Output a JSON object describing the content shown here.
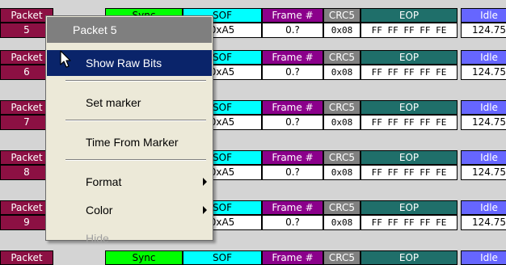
{
  "header_labels": {
    "packet": "Packet",
    "sync": "Sync",
    "sof": "SOF",
    "frame": "Frame #",
    "crc5": "CRC5",
    "eop": "EOP",
    "idle": "Idle"
  },
  "rows": [
    {
      "packet": "5",
      "sof": "0xA5",
      "frame": "0.?",
      "crc5": "0x08",
      "eop": "FF FF FF FF FE",
      "idle": "124.75"
    },
    {
      "packet": "6",
      "sof": "0xA5",
      "frame": "0.?",
      "crc5": "0x08",
      "eop": "FF FF FF FF FE",
      "idle": "124.75"
    },
    {
      "packet": "7",
      "sof": "0xA5",
      "frame": "0.?",
      "crc5": "0x08",
      "eop": "FF FF FF FF FE",
      "idle": "124.75"
    },
    {
      "packet": "8",
      "sof": "0xA5",
      "frame": "0.?",
      "crc5": "0x08",
      "eop": "FF FF FF FF FE",
      "idle": "124.75"
    },
    {
      "packet": "9",
      "sof": "0xA5",
      "frame": "0.?",
      "crc5": "0x08",
      "eop": "FF FF FF FF FE",
      "idle": "124.75"
    }
  ],
  "context_menu": {
    "title": "Packet 5",
    "show_raw_bits": "Show Raw Bits",
    "set_marker": "Set marker",
    "time_from_marker": "Time From Marker",
    "format": "Format",
    "color": "Color",
    "hide": "Hide"
  },
  "colors": {
    "packet": "#8c1043",
    "sync": "#00ff00",
    "sof": "#00ffff",
    "frame": "#8b008b",
    "crc5": "#808080",
    "eop": "#1f6f6a",
    "idle": "#6666ff",
    "menu_highlight": "#0a246a"
  },
  "icons": {
    "cursor": "arrow-pointer-icon",
    "submenu": "triangle-right-icon"
  }
}
